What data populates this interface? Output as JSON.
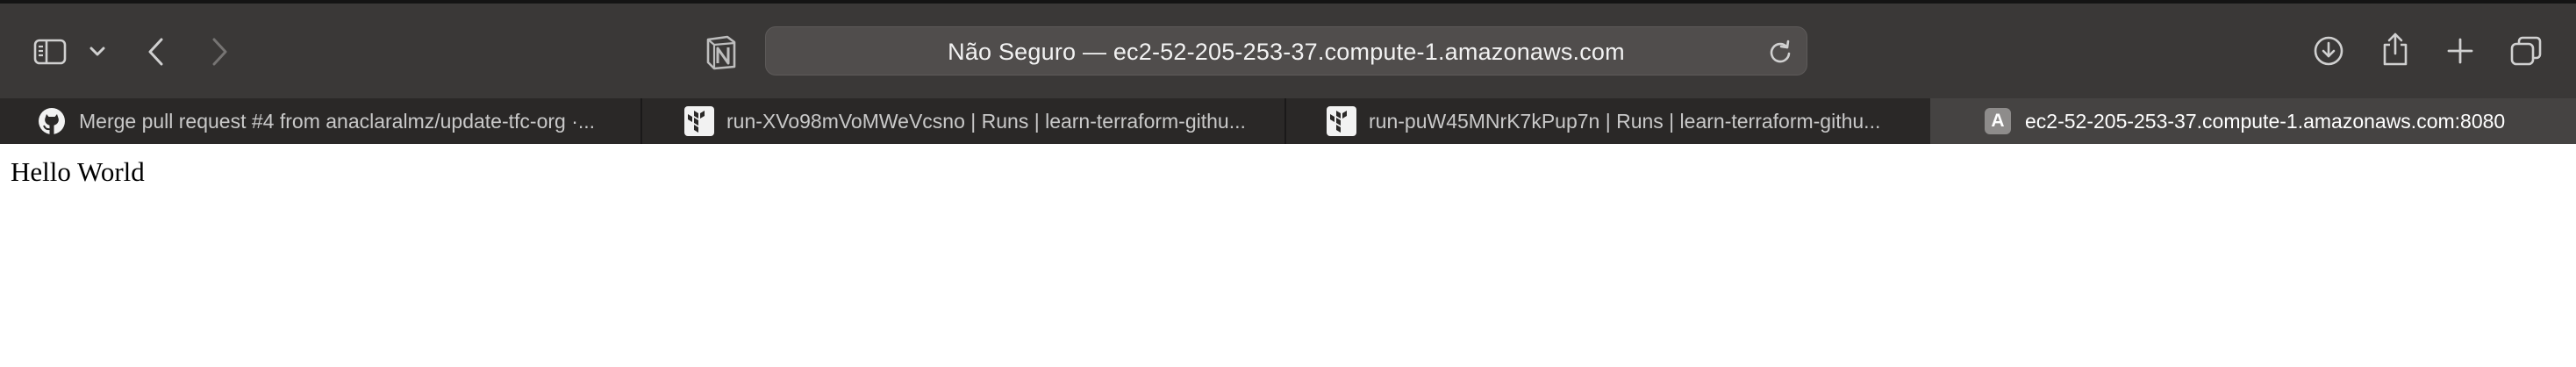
{
  "toolbar": {
    "url_text": "Não Seguro — ec2-52-205-253-37.compute-1.amazonaws.com",
    "icons": [
      "sidebar-icon",
      "chevron-down-icon",
      "back-icon",
      "forward-icon",
      "notion-icon",
      "reload-icon",
      "download-icon",
      "share-icon",
      "new-tab-icon",
      "tab-overview-icon"
    ]
  },
  "tabs": [
    {
      "label": "Merge pull request #4 from anaclaralmz/update-tfc-org ·...",
      "icon": "github-icon",
      "active": false
    },
    {
      "label": "run-XVo98mVoMWeVcsno | Runs | learn-terraform-githu...",
      "icon": "terraform-icon",
      "active": false
    },
    {
      "label": "run-puW45MNrK7kPup7n | Runs | learn-terraform-githu...",
      "icon": "terraform-icon",
      "active": false
    },
    {
      "label": "ec2-52-205-253-37.compute-1.amazonaws.com:8080",
      "icon": "letter-a-icon",
      "icon_letter": "A",
      "active": true
    }
  ],
  "page": {
    "text": "Hello World"
  }
}
